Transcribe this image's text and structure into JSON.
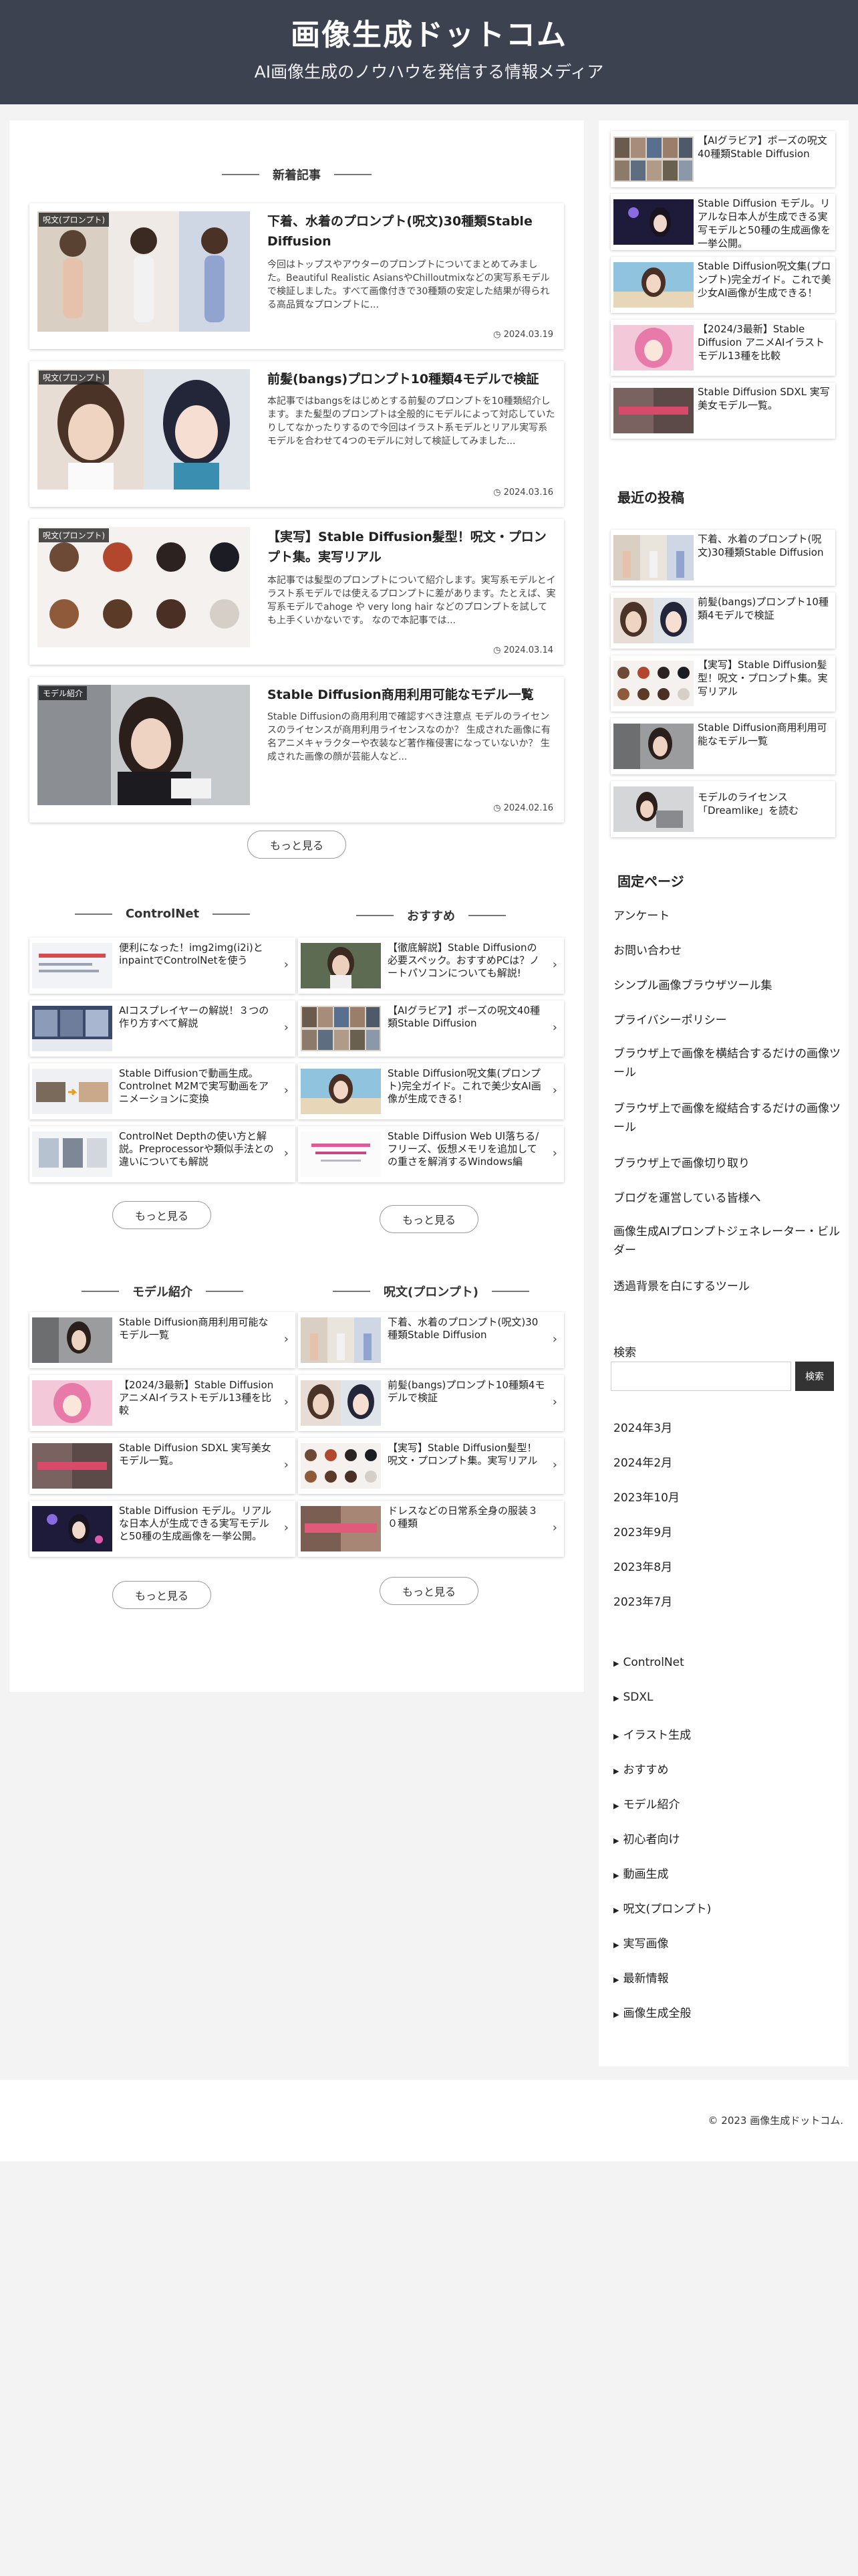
{
  "header": {
    "logo": "画像生成ドットコム",
    "tagline": "AI画像生成のノウハウを発信する情報メディア"
  },
  "main": {
    "new_title": "新着記事",
    "cards": [
      {
        "badge": "呪文(プロンプト)",
        "title": "下着、水着のプロンプト(呪文)30種類Stable Diffusion",
        "snippet": "今回はトップスやアウターのプロンプトについてまとめてみました。Beautiful Realistic AsiansやChilloutmixなどの実写系モデルで検証しました。すべて画像付きで30種類の安定した結果が得られる高品質なプロンプトに...",
        "date": "2024.03.19"
      },
      {
        "badge": "呪文(プロンプト)",
        "title": "前髪(bangs)プロンプト10種類4モデルで検証",
        "snippet": "本記事ではbangsをはじめとする前髪のプロンプトを10種類紹介します。また髪型のプロンプトは全般的にモデルによって対応していたりしてなかったりするので今回はイラスト系モデルとリアル実写系モデルを合わせて4つのモデルに対して検証してみました...",
        "date": "2024.03.16"
      },
      {
        "badge": "呪文(プロンプト)",
        "title": "【実写】Stable Diffusion髪型！呪文・プロンプト集。実写リアル",
        "snippet": "本記事では髪型のプロンプトについて紹介します。実写系モデルとイラスト系モデルでは使えるプロンプトに差があります。たとえば、実写系モデルでahoge や very long hair などのプロンプトを試しても上手くいかないです。 なので本記事では...",
        "date": "2024.03.14"
      },
      {
        "badge": "モデル紹介",
        "title": "Stable Diffusion商用利用可能なモデル一覧",
        "snippet": "Stable Diffusionの商用利用で確認すべき注意点 モデルのライセンスのライセンスが商用利用ライセンスなのか？ 生成された画像に有名アニメキャラクターや衣装など著作権侵害になっていないか？ 生成された画像の顔が芸能人など...",
        "date": "2024.02.16"
      }
    ],
    "more": "もっと見る",
    "cols": [
      {
        "title": "ControlNet",
        "items": [
          "便利になった！img2img(i2i)とinpaintでControlNetを使う",
          "AIコスプレイヤーの解説！３つの作り方すべて解説",
          "Stable Diffusionで動画生成。Controlnet M2Mで実写動画をアニメーションに変換",
          "ControlNet Depthの使い方と解説。Preprocessorや類似手法との違いについても解説"
        ]
      },
      {
        "title": "おすすめ",
        "items": [
          "【徹底解説】Stable Diffusionの必要スペック。おすすめPCは？ノートパソコンについても解説!",
          "【AIグラビア】ポーズの呪文40種類Stable Diffusion",
          "Stable Diffusion呪文集(プロンプト)完全ガイド。これで美少女AI画像が生成できる！",
          "Stable Diffusion Web UI落ちる/フリーズ、仮想メモリを追加しての重さを解消するWindows編"
        ]
      },
      {
        "title": "モデル紹介",
        "items": [
          "Stable Diffusion商用利用可能なモデル一覧",
          "【2024/3最新】Stable Diffusion アニメAIイラストモデル13種を比較",
          "Stable Diffusion SDXL 実写美女モデル一覧。",
          "Stable Diffusion モデル。リアルな日本人が生成できる実写モデルと50種の生成画像を一挙公開。"
        ]
      },
      {
        "title": "呪文(プロンプト)",
        "items": [
          "下着、水着のプロンプト(呪文)30種類Stable Diffusion",
          "前髪(bangs)プロンプト10種類4モデルで検証",
          "【実写】Stable Diffusion髪型！呪文・プロンプト集。実写リアル",
          "ドレスなどの日常系全身の服装３０種類"
        ]
      }
    ]
  },
  "sidebar": {
    "top_items": [
      "【AIグラビア】ポーズの呪文40種類Stable Diffusion",
      "Stable Diffusion モデル。リアルな日本人が生成できる実写モデルと50種の生成画像を一挙公開。",
      "Stable Diffusion呪文集(プロンプト)完全ガイド。これで美少女AI画像が生成できる！",
      "【2024/3最新】Stable Diffusion アニメAIイラストモデル13種を比較",
      "Stable Diffusion SDXL 実写美女モデル一覧。"
    ],
    "recent_title": "最近の投稿",
    "recent_items": [
      "下着、水着のプロンプト(呪文)30種類Stable Diffusion",
      "前髪(bangs)プロンプト10種類4モデルで検証",
      "【実写】Stable Diffusion髪型！呪文・プロンプト集。実写リアル",
      "Stable Diffusion商用利用可能なモデル一覧",
      "モデルのライセンス「Dreamlike」を読む"
    ],
    "fixed_title": "固定ページ",
    "fixed_links": [
      "アンケート",
      "お問い合わせ",
      "シンプル画像ブラウザツール集",
      "プライバシーポリシー",
      "ブラウザ上で画像を横結合するだけの画像ツール",
      "ブラウザ上で画像を縦結合するだけの画像ツール",
      "ブラウザ上で画像切り取り",
      "ブログを運営している皆様へ",
      "画像生成AIプロンプトジェネレーター・ビルダー",
      "透過背景を白にするツール"
    ],
    "search_label": "検索",
    "search_placeholder": "",
    "search_button": "検索",
    "archives": [
      "2024年3月",
      "2024年2月",
      "2023年10月",
      "2023年9月",
      "2023年8月",
      "2023年7月"
    ],
    "categories": [
      "ControlNet",
      "SDXL",
      "イラスト生成",
      "おすすめ",
      "モデル紹介",
      "初心者向け",
      "動画生成",
      "呪文(プロンプト)",
      "実写画像",
      "最新情報",
      "画像生成全般"
    ]
  },
  "footer": {
    "copyright": "© 2023 画像生成ドットコム."
  },
  "icons": {
    "chevron": "chevron-right-icon",
    "category_bullet": "triangle-right-icon",
    "date": "clock-icon"
  },
  "colors": {
    "header_bg": "#3d4250",
    "page_bg": "#f3f3f4",
    "search_button": "#333333"
  }
}
